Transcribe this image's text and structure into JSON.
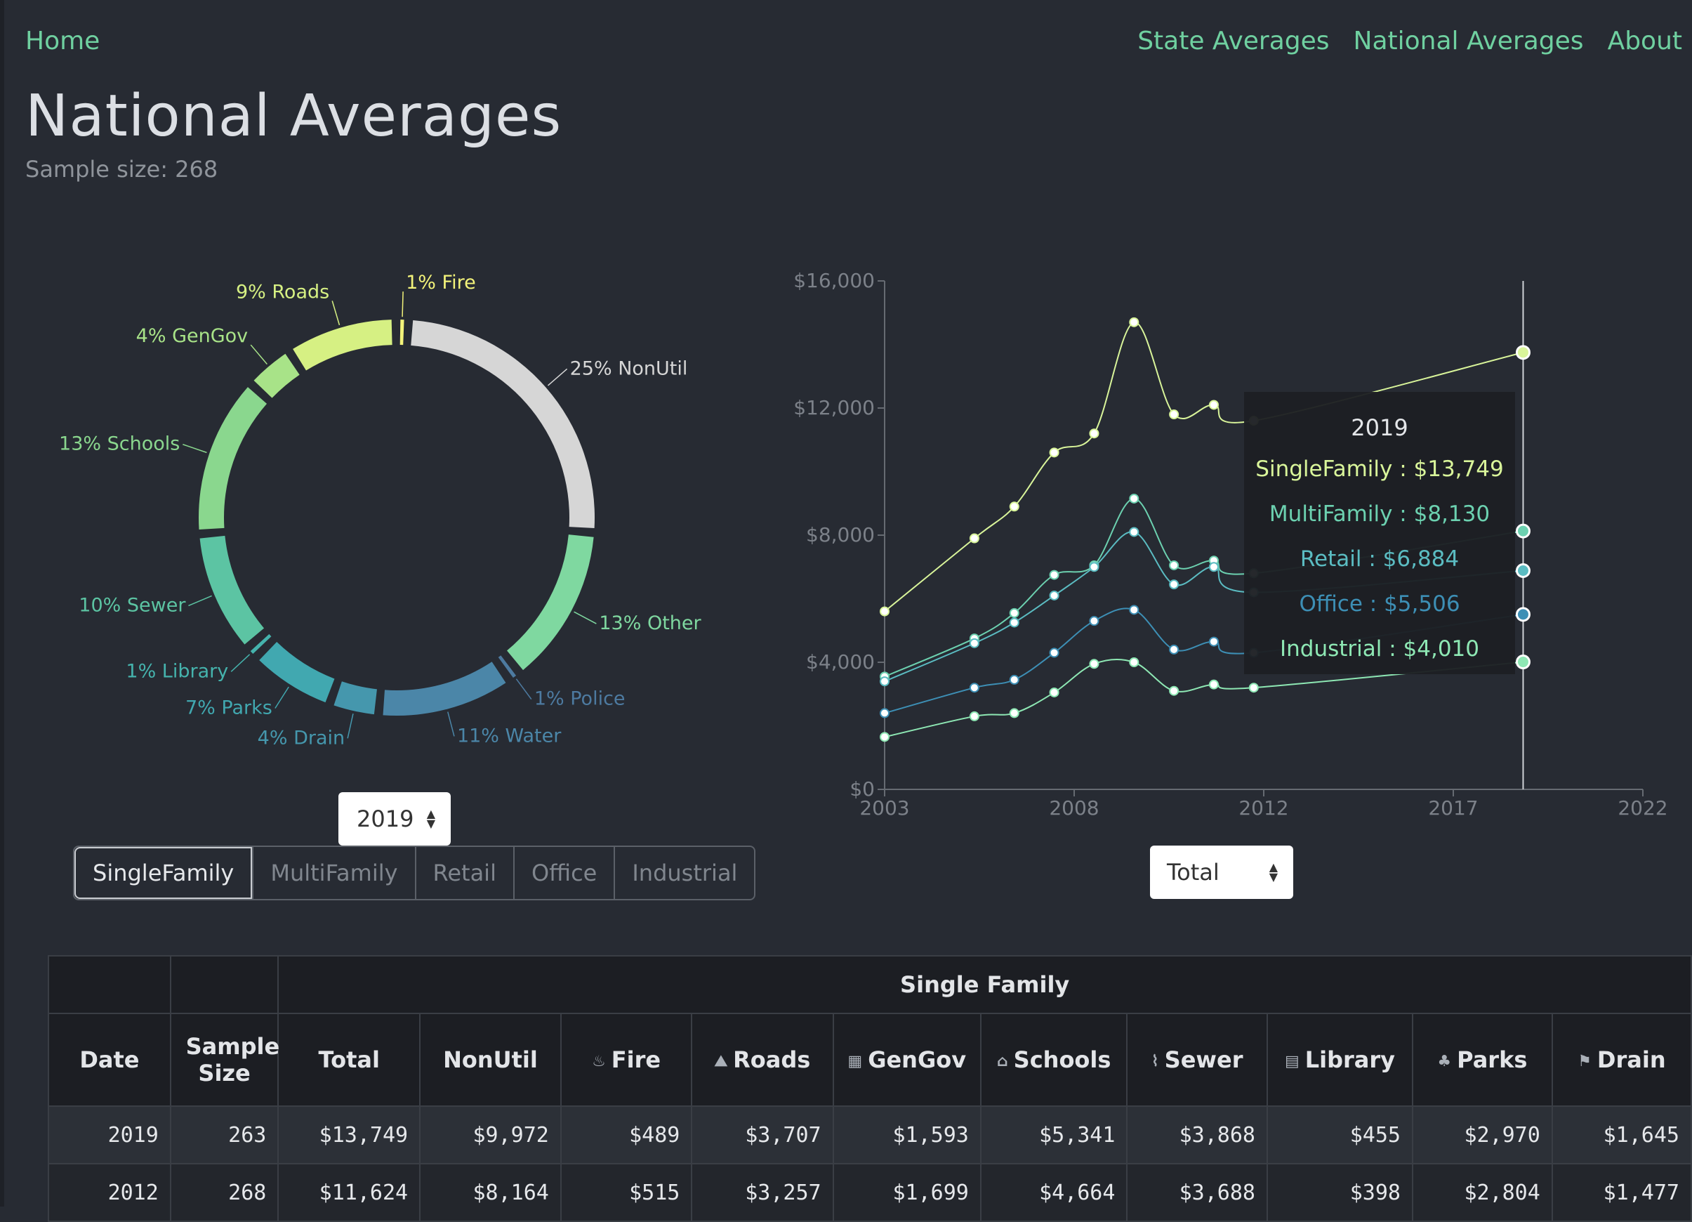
{
  "nav": {
    "home": "Home",
    "state": "State Averages",
    "national": "National Averages",
    "about": "About"
  },
  "page": {
    "title": "National Averages",
    "sample": "Sample size: 268"
  },
  "donut": {
    "year": "2019",
    "slices": [
      {
        "label": "25% NonUtil",
        "value": 25,
        "color": "#d6d6d6"
      },
      {
        "label": "13% Other",
        "value": 13,
        "color": "#7fd8a0"
      },
      {
        "label": "1% Police",
        "value": 1,
        "color": "#4d7aa0"
      },
      {
        "label": "11% Water",
        "value": 11,
        "color": "#4b86a8"
      },
      {
        "label": "4% Drain",
        "value": 4,
        "color": "#4597ad"
      },
      {
        "label": "7% Parks",
        "value": 7,
        "color": "#41a8b0"
      },
      {
        "label": "1% Library",
        "value": 1,
        "color": "#45b3ad"
      },
      {
        "label": "10% Sewer",
        "value": 10,
        "color": "#5cc4a3"
      },
      {
        "label": "13% Schools",
        "value": 13,
        "color": "#8ad78e"
      },
      {
        "label": "4% GenGov",
        "value": 4,
        "color": "#a8e388"
      },
      {
        "label": "9% Roads",
        "value": 9,
        "color": "#d6f083"
      },
      {
        "label": "1% Fire",
        "value": 1,
        "color": "#f3f37a"
      }
    ]
  },
  "controls": {
    "types": [
      "SingleFamily",
      "MultiFamily",
      "Retail",
      "Office",
      "Industrial"
    ],
    "metric": "Total"
  },
  "chart_data": {
    "type": "line",
    "x": [
      2003,
      2005.25,
      2006.25,
      2007.25,
      2008.25,
      2009.25,
      2010.25,
      2011.25,
      2012.25,
      2019
    ],
    "xticks": [
      "2003",
      "2008",
      "2012",
      "2017",
      "2022"
    ],
    "yticks": [
      "$0",
      "$4,000",
      "$8,000",
      "$12,000",
      "$16,000"
    ],
    "xlim": [
      2003,
      2022
    ],
    "ylim": [
      0,
      16000
    ],
    "series": [
      {
        "name": "SingleFamily",
        "color": "#d9f59a",
        "values": [
          5600,
          7900,
          8900,
          10600,
          11200,
          14700,
          11800,
          12100,
          11600,
          13749
        ]
      },
      {
        "name": "MultiFamily",
        "color": "#6cd1b0",
        "values": [
          3550,
          4750,
          5550,
          6750,
          7050,
          9150,
          7050,
          7200,
          6800,
          8130
        ]
      },
      {
        "name": "Retail",
        "color": "#5bbcc2",
        "values": [
          3400,
          4600,
          5250,
          6100,
          7000,
          8100,
          6450,
          7000,
          6200,
          6884
        ]
      },
      {
        "name": "Office",
        "color": "#3d8fb5",
        "values": [
          2400,
          3200,
          3450,
          4300,
          5300,
          5650,
          4400,
          4650,
          4300,
          5506
        ]
      },
      {
        "name": "Industrial",
        "color": "#8ee8b4",
        "values": [
          1650,
          2300,
          2400,
          3050,
          3950,
          4000,
          3100,
          3300,
          3200,
          4010
        ]
      }
    ],
    "tooltip": {
      "title": "2019",
      "rows": [
        {
          "text": "SingleFamily : $13,749",
          "color": "#d9f59a"
        },
        {
          "text": "MultiFamily : $8,130",
          "color": "#6cd1b0"
        },
        {
          "text": "Retail : $6,884",
          "color": "#5bbcc2"
        },
        {
          "text": "Office : $5,506",
          "color": "#3d8fb5"
        },
        {
          "text": "Industrial : $4,010",
          "color": "#8ee8b4"
        }
      ]
    }
  },
  "table": {
    "group_header": "Single Family",
    "headers": [
      {
        "label": "Date",
        "icon": ""
      },
      {
        "label": "Sample Size",
        "icon": ""
      },
      {
        "label": "Total",
        "icon": ""
      },
      {
        "label": "NonUtil",
        "icon": ""
      },
      {
        "label": "Fire",
        "icon": "fire-icon"
      },
      {
        "label": "Roads",
        "icon": "road-icon"
      },
      {
        "label": "GenGov",
        "icon": "building-icon"
      },
      {
        "label": "Schools",
        "icon": "school-icon"
      },
      {
        "label": "Sewer",
        "icon": "sewer-icon"
      },
      {
        "label": "Library",
        "icon": "book-icon"
      },
      {
        "label": "Parks",
        "icon": "tree-icon"
      },
      {
        "label": "Drain",
        "icon": "flag-icon"
      }
    ],
    "rows": [
      [
        "2019",
        "263",
        "$13,749",
        "$9,972",
        "$489",
        "$3,707",
        "$1,593",
        "$5,341",
        "$3,868",
        "$455",
        "$2,970",
        "$1,645"
      ],
      [
        "2012",
        "268",
        "$11,624",
        "$8,164",
        "$515",
        "$3,257",
        "$1,699",
        "$4,664",
        "$3,688",
        "$398",
        "$2,804",
        "$1,477"
      ]
    ]
  }
}
